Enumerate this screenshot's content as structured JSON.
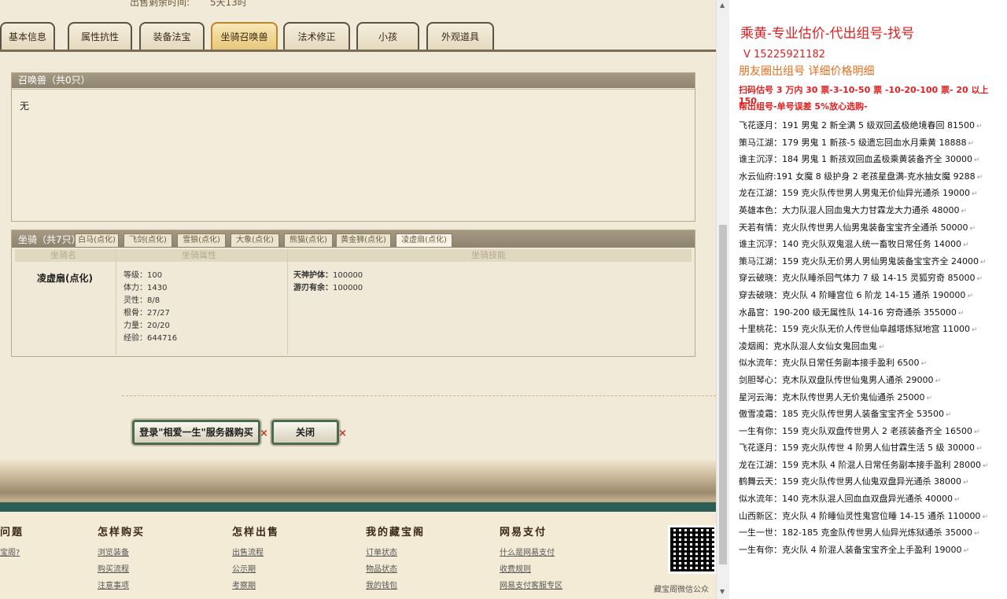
{
  "game": {
    "top_info": {
      "label": "出售剩余时间:",
      "value": "5天13时"
    },
    "tabs": [
      "基本信息",
      "属性抗性",
      "装备法宝",
      "坐骑召唤兽",
      "法术修正",
      "小孩",
      "外观道具"
    ],
    "active_tab": "坐骑召唤兽",
    "summon_panel": {
      "title": "召唤兽（共0只）",
      "empty_text": "无"
    },
    "mount_panel": {
      "title": "坐骑（共7只）",
      "tabs": [
        "白马(点化)",
        "飞剑(点化)",
        "雪狼(点化)",
        "大象(点化)",
        "熊猫(点化)",
        "黄金狮(点化)",
        "凌虚扇(点化)"
      ],
      "active_tab": "凌虚扇(点化)",
      "columns": [
        "坐骑名",
        "坐骑属性",
        "坐骑技能"
      ],
      "mount_name": "凌虚扇(点化)",
      "attributes": [
        "等级：100",
        "体力：1430",
        "灵性：8/8",
        "根骨：27/27",
        "力量：20/20",
        "经验：644716"
      ],
      "skills": [
        {
          "name": "天神护体：",
          "value": "100000"
        },
        {
          "name": "游刃有余：",
          "value": "100000"
        }
      ]
    },
    "buttons": {
      "login_buy": "登录\"相爱一生\"服务器购买",
      "close": "关闭"
    },
    "footer": {
      "columns": [
        {
          "head": "问题",
          "links": [
            "宝阁?"
          ]
        },
        {
          "head": "怎样购买",
          "links": [
            "浏览装备",
            "购买流程",
            "注意事项"
          ]
        },
        {
          "head": "怎样出售",
          "links": [
            "出售流程",
            "公示期",
            "考察期"
          ]
        },
        {
          "head": "我的藏宝阁",
          "links": [
            "订单状态",
            "物品状态",
            "我的钱包"
          ]
        },
        {
          "head": "网易支付",
          "links": [
            "什么是网易支付",
            "收费规则",
            "网易支付客服专区"
          ]
        }
      ],
      "qr_caption": "藏宝阁微信公众"
    }
  },
  "ad": {
    "title": "乘黄-专业估价-代出组号-找号",
    "phone": "V 15225921182",
    "moments": "朋友圈出组号    详细价格明细",
    "price_line": "扫码估号 3 万内 30 票-3-10-50 票  -10-20-100 票- 20 以上 150",
    "help_line": "帮出组号-单号误差 5%放心选购-",
    "listings": [
      "飞花逐月：191 男鬼 2 新全满 5 级双回孟极绝境春回 81500",
      "策马江湖：179 男鬼 1 新孩-5 级遗忘回血水月乘黄 18888",
      "谁主沉浮：184 男鬼 1 新孩双回血孟极乘黄装备齐全 30000",
      "水云仙府:191 女魔 8 级护身 2 老孩星盘满-克水抽女魔 9288",
      "龙在江湖：159 克火队传世男人男鬼无价仙异光通杀 19000",
      "英雄本色：大力队混人回血鬼大力甘霖龙大力通杀 48000",
      "天若有情：克火队传世男人仙男鬼装备宝宝齐全通杀 50000",
      "谁主沉浮：140 克火队双鬼混人统一畜牧日常任务 14000",
      "策马江湖：159 克火队无价男人男仙男鬼装备宝宝齐全 24000",
      "穿云破晓：克火队睡杀回气体力 7 级 14-15 灵狐穷奇 85000",
      "穿去破晓：克火队 4 阶睡宫位 6 阶龙 14-15 通杀 190000",
      "水晶宫：190-200 级无属性队 14-16 穷奇通杀 355000",
      "十里桃花：159 克火队无价人传世仙阜越塔炼狱地宫 11000",
      "凌烟阁：克水队混人女仙女鬼回血鬼",
      "似水流年：克火队日常任务副本接手盈利 6500",
      "剑胆琴心：克木队双盘队传世仙鬼男人通杀 29000",
      "星河云海：克木队传世男人无价鬼仙通杀 25000",
      "傲雪凌霜：185 克火队传世男人装备宝宝齐全 53500",
      "一生有你：159 克火队双盘传世男人 2 老孩装备齐全 16500",
      "飞花逐月：159 克火队传世 4 阶男人仙甘霖生活 5 级 30000",
      "龙在江湖：159 克木队 4 阶混人日常任务副本接手盈利 28000",
      "鹤舞云天：159 克火队传世男人仙鬼双盘异光通杀 38000",
      "似水流年：140 克木队混人回血血双盘异光通杀 40000",
      "山西新区：克火队 4 阶睡仙灵性鬼宫位睡 14-15 通杀 110000",
      "一生一世：182-185 克金队传世男人仙异光炼狱通杀 35000",
      "一生有你：克火队 4 阶混人装备宝宝齐全上手盈利 19000"
    ]
  },
  "colors": {
    "ad_red": "#e02020",
    "ad_orange": "#e07020",
    "active_tab": "#e7c778",
    "footer_green": "#2d5e56"
  },
  "icons": {
    "close_x": "×",
    "scroll_up": "▲",
    "scroll_down": "▼"
  }
}
